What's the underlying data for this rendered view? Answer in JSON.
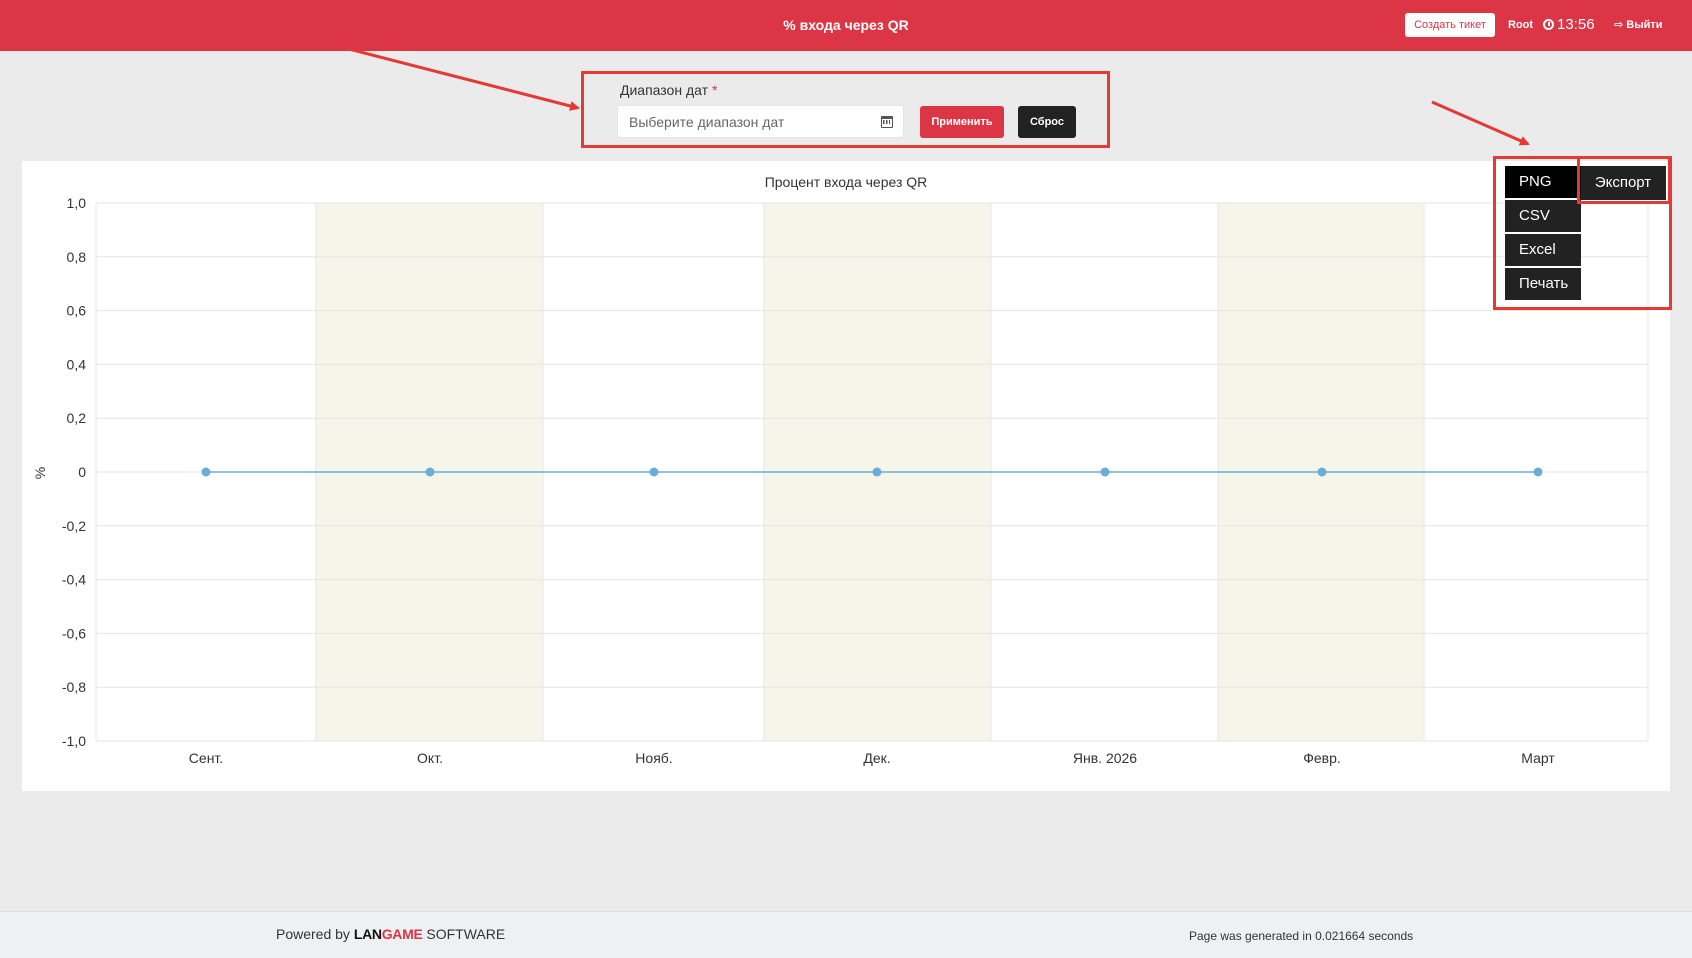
{
  "header": {
    "title": "% входа через QR",
    "create_ticket_label": "Создать тикет",
    "user": "Root",
    "time": "13:56",
    "logout_label": "Выйти"
  },
  "filter": {
    "label": "Диапазон дат",
    "required_mark": "*",
    "placeholder": "Выберите диапазон дат",
    "apply_label": "Применить",
    "reset_label": "Сброс"
  },
  "export": {
    "button_label": "Экспорт",
    "options": [
      "PNG",
      "CSV",
      "Excel",
      "Печать"
    ],
    "active_option": "PNG"
  },
  "chart_data": {
    "type": "line",
    "title": "Процент входа через QR",
    "xlabel": "",
    "ylabel": "%",
    "categories": [
      "Сент.",
      "Окт.",
      "Нояб.",
      "Дек.",
      "Янв. 2026",
      "Февр.",
      "Март"
    ],
    "y_ticks": [
      "1,0",
      "0,8",
      "0,6",
      "0,4",
      "0,2",
      "0",
      "-0,2",
      "-0,4",
      "-0,6",
      "-0,8",
      "-1,0"
    ],
    "ylim": [
      -1.0,
      1.0
    ],
    "series": [
      {
        "values": [
          0,
          0,
          0,
          0,
          0,
          0,
          0
        ],
        "color": "#6aaed6"
      }
    ],
    "alternating_bands": true,
    "band_color": "#f5f5ea",
    "grid": true
  },
  "footer": {
    "powered_prefix": "Powered by",
    "brand_part1": "LAN",
    "brand_part2": "GAME",
    "brand_suffix": "SOFTWARE",
    "generated_text": "Page was generated in 0.021664 seconds"
  }
}
